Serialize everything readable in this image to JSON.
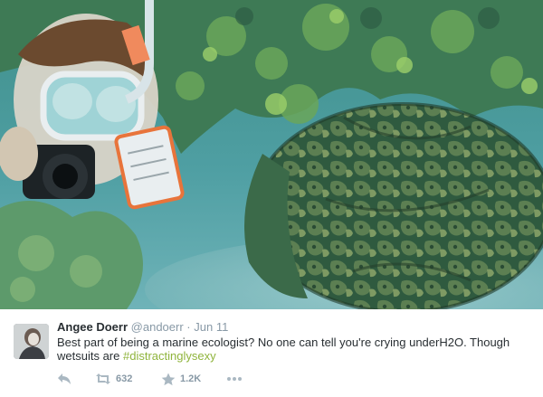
{
  "tweet": {
    "author": {
      "name": "Angee Doerr",
      "handle": "@andoerr",
      "separator": "·"
    },
    "date": "Jun 11",
    "text_before": "Best part of being a marine ecologist? No one can tell you're crying underH2O. Though wetsuits are ",
    "hashtag": "#distractinglysexy",
    "photo_description": "Underwater photo: a snorkeler in a mask holding a camera beside a green sea turtle resting under a coral ledge"
  },
  "actions": {
    "reply_icon": "reply-icon",
    "retweet_icon": "retweet-icon",
    "retweet_count": "632",
    "favorite_icon": "star-icon",
    "favorite_count": "1.2K",
    "more_icon": "more-dots-icon"
  },
  "colors": {
    "name": "#292f33",
    "meta": "#8899a6",
    "hashtag": "#8fb43c",
    "water": "#4a9a9c"
  }
}
